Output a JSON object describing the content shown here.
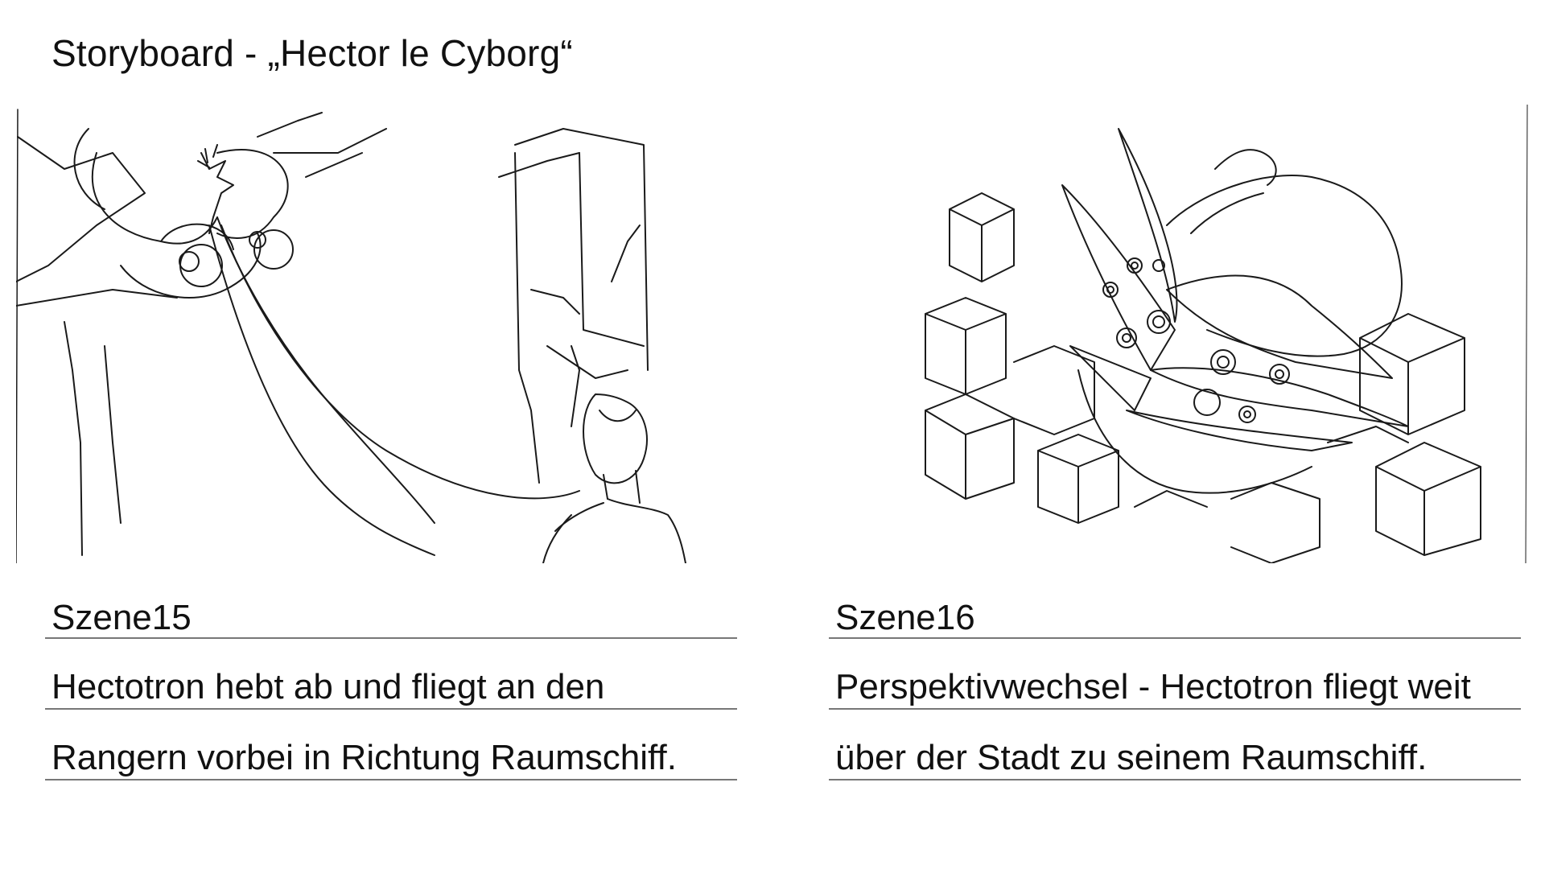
{
  "title": "Storyboard - „Hector le Cyborg“",
  "scenes": [
    {
      "label": "Szene15",
      "lines": [
        "Hectotron hebt ab und fliegt an den",
        "Rangern vorbei in Richtung Raumschiff."
      ],
      "sketch": "pencil-sketch-cyborg-flying-past-ranger"
    },
    {
      "label": "Szene16",
      "lines": [
        "Perspektivwechsel - Hectotron fliegt weit",
        "über der Stadt zu seinem Raumschiff."
      ],
      "sketch": "pencil-sketch-spaceship-above-city"
    }
  ]
}
